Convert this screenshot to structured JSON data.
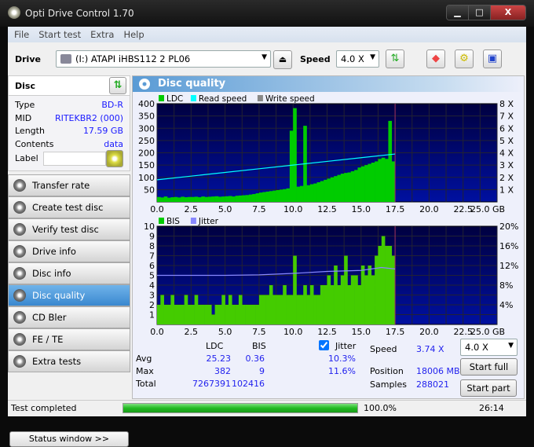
{
  "window": {
    "title": "Opti Drive Control 1.70",
    "minimize": "▁",
    "maximize": "□",
    "close": "X"
  },
  "menu": [
    "File",
    "Start test",
    "Extra",
    "Help"
  ],
  "toolbar": {
    "drive_label": "Drive",
    "drive_value": "(I:)  ATAPI iHBS112   2 PL06",
    "speed_label": "Speed",
    "speed_value": "4.0 X"
  },
  "disc": {
    "title": "Disc",
    "rows": [
      {
        "k": "Type",
        "v": "BD-R"
      },
      {
        "k": "MID",
        "v": "RITEKBR2 (000)"
      },
      {
        "k": "Length",
        "v": "17.59 GB"
      },
      {
        "k": "Contents",
        "v": "data"
      }
    ],
    "label_label": "Label",
    "label_value": ""
  },
  "nav": [
    {
      "label": "Transfer rate"
    },
    {
      "label": "Create test disc"
    },
    {
      "label": "Verify test disc"
    },
    {
      "label": "Drive info"
    },
    {
      "label": "Disc info"
    },
    {
      "label": "Disc quality",
      "active": true
    },
    {
      "label": "CD Bler"
    },
    {
      "label": "FE / TE"
    },
    {
      "label": "Extra tests"
    }
  ],
  "status_window": "Status window >>",
  "panel": {
    "title": "Disc quality"
  },
  "stats": {
    "col_ldc": "LDC",
    "col_bis": "BIS",
    "jitter_label": "Jitter",
    "jitter_checked": true,
    "rows": [
      {
        "k": "Avg",
        "ldc": "25.23",
        "bis": "0.36",
        "jit": "10.3%"
      },
      {
        "k": "Max",
        "ldc": "382",
        "bis": "9",
        "jit": "11.6%"
      },
      {
        "k": "Total",
        "ldc": "7267391",
        "bis": "102416",
        "jit": ""
      }
    ],
    "speed_label": "Speed",
    "speed_value": "3.74 X",
    "position_label": "Position",
    "position_value": "18006 MB",
    "samples_label": "Samples",
    "samples_value": "288021",
    "speed_select": "4.0 X",
    "start_full": "Start full",
    "start_part": "Start part"
  },
  "statusbar": {
    "text": "Test completed",
    "progress": 100.0,
    "progress_text": "100.0%",
    "time": "26:14"
  },
  "colors": {
    "plot_bg_top": "#000040",
    "plot_bg_bottom": "#0010a0",
    "ldc": "#00cc00",
    "read_speed": "#00ffff",
    "bis": "#44cc00",
    "jitter": "#8888ff",
    "accent": "#3a88cf"
  },
  "chart_data": [
    {
      "type": "bar",
      "legend": [
        "LDC",
        "Read speed",
        "Write speed"
      ],
      "x_ticks": [
        "0.0",
        "2.5",
        "5.0",
        "7.5",
        "10.0",
        "12.5",
        "15.0",
        "17.5",
        "20.0",
        "22.5",
        "25.0 GB"
      ],
      "xlim": [
        0,
        25
      ],
      "ylim": [
        0,
        400
      ],
      "y_ticks": [
        "50",
        "100",
        "150",
        "200",
        "250",
        "300",
        "350",
        "400"
      ],
      "y2_ticks": [
        "1 X",
        "2 X",
        "3 X",
        "4 X",
        "5 X",
        "6 X",
        "7 X",
        "8 X"
      ],
      "y2lim": [
        0,
        8
      ],
      "grid": true,
      "bin_width": 0.25,
      "ldc": [
        20,
        18,
        22,
        17,
        19,
        20,
        18,
        21,
        19,
        20,
        20,
        21,
        19,
        22,
        20,
        21,
        22,
        23,
        21,
        22,
        23,
        24,
        22,
        25,
        26,
        27,
        28,
        30,
        32,
        35,
        38,
        40,
        42,
        44,
        46,
        48,
        50,
        52,
        55,
        290,
        382,
        62,
        65,
        310,
        68,
        72,
        75,
        80,
        85,
        90,
        95,
        100,
        105,
        110,
        115,
        118,
        120,
        125,
        130,
        140,
        145,
        150,
        155,
        160,
        165,
        175,
        180,
        175,
        330,
        165
      ],
      "read_speed": [
        [
          0,
          1.8
        ],
        [
          2.5,
          2.1
        ],
        [
          5,
          2.4
        ],
        [
          7.5,
          2.7
        ],
        [
          10,
          3.0
        ],
        [
          12.5,
          3.3
        ],
        [
          15,
          3.6
        ],
        [
          17.5,
          3.9
        ]
      ]
    },
    {
      "type": "bar",
      "legend": [
        "BIS",
        "Jitter"
      ],
      "x_ticks": [
        "0.0",
        "2.5",
        "5.0",
        "7.5",
        "10.0",
        "12.5",
        "15.0",
        "17.5",
        "20.0",
        "22.5",
        "25.0 GB"
      ],
      "xlim": [
        0,
        25
      ],
      "ylim": [
        0,
        10
      ],
      "y_ticks": [
        "1",
        "2",
        "3",
        "4",
        "5",
        "6",
        "7",
        "8",
        "9",
        "10"
      ],
      "y2_ticks": [
        "4%",
        "8%",
        "12%",
        "16%",
        "20%"
      ],
      "y2lim": [
        0,
        20
      ],
      "grid": true,
      "bin_width": 0.25,
      "bis": [
        2,
        3,
        2,
        2,
        3,
        2,
        2,
        2,
        3,
        2,
        2,
        3,
        2,
        2,
        2,
        2,
        1,
        2,
        2,
        3,
        2,
        3,
        2,
        2,
        3,
        2,
        2,
        2,
        2,
        2,
        3,
        3,
        3,
        4,
        3,
        3,
        3,
        4,
        3,
        3,
        7,
        3,
        3,
        4,
        3,
        4,
        3,
        3,
        4,
        4,
        5,
        4,
        6,
        4,
        5,
        7,
        4,
        5,
        5,
        4,
        6,
        5,
        6,
        5,
        7,
        8,
        9,
        8,
        8,
        7
      ],
      "jitter": [
        [
          0,
          10.0
        ],
        [
          2.5,
          10.0
        ],
        [
          5,
          10.0
        ],
        [
          7.5,
          10.1
        ],
        [
          10,
          10.4
        ],
        [
          12.5,
          10.8
        ],
        [
          15,
          11.0
        ],
        [
          16.5,
          11.6
        ],
        [
          17.5,
          11.3
        ]
      ]
    }
  ]
}
